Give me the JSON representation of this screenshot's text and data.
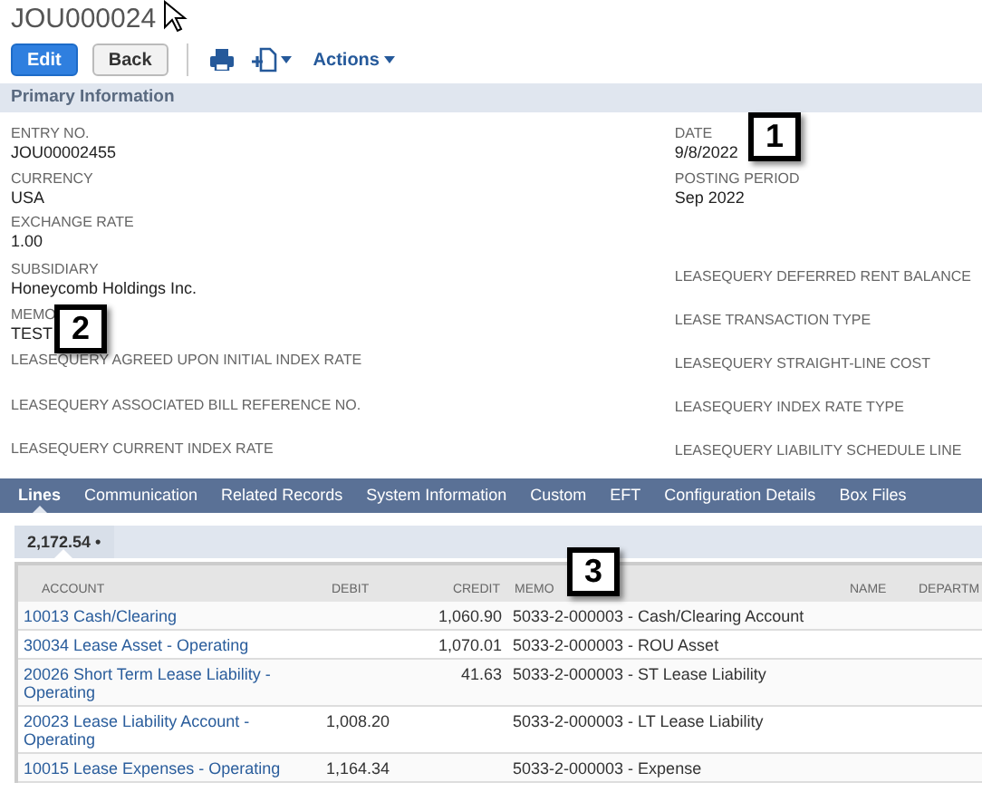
{
  "record": {
    "title": "JOU000024"
  },
  "toolbar": {
    "buttons": [
      {
        "label": "Edit",
        "kind": "primary"
      },
      {
        "label": "Back",
        "kind": "secondary"
      }
    ],
    "actions": {
      "label": "Actions"
    }
  },
  "primary_information": {
    "title": "Primary Information",
    "left_fields": [
      {
        "label": "ENTRY NO.",
        "value": "JOU00002455"
      },
      {
        "label": "CURRENCY",
        "value": "USA"
      },
      {
        "label": "EXCHANGE RATE",
        "value": "1.00"
      },
      {
        "label": "SUBSIDIARY",
        "value": "Honeycomb Holdings Inc."
      },
      {
        "label": "MEMO",
        "value": "TEST"
      },
      {
        "label": "LEASEQUERY AGREED UPON INITIAL INDEX RATE"
      },
      {
        "label": "LEASEQUERY ASSOCIATED BILL REFERENCE NO."
      },
      {
        "label": "LEASEQUERY CURRENT INDEX RATE"
      }
    ],
    "right_fields": [
      {
        "label": "DATE",
        "value": "9/8/2022"
      },
      {
        "label": "POSTING PERIOD",
        "value": "Sep 2022"
      },
      {
        "label": "LEASEQUERY DEFERRED RENT BALANCE"
      },
      {
        "label": "LEASE TRANSACTION TYPE"
      },
      {
        "label": "LEASEQUERY STRAIGHT-LINE COST"
      },
      {
        "label": "LEASEQUERY INDEX RATE TYPE"
      },
      {
        "label": "LEASEQUERY LIABILITY SCHEDULE LINE"
      }
    ]
  },
  "tabs": [
    {
      "label": "Lines",
      "selected": true
    },
    {
      "label": "Communication",
      "selected": false
    },
    {
      "label": "Related Records",
      "selected": false
    },
    {
      "label": "System Information",
      "selected": false
    },
    {
      "label": "Custom",
      "selected": false
    },
    {
      "label": "EFT",
      "selected": false
    },
    {
      "label": "Configuration Details",
      "selected": false
    },
    {
      "label": "Box Files",
      "selected": false
    }
  ],
  "subtabs": [
    {
      "label": "2,172.54 •",
      "selected": true
    }
  ],
  "table": {
    "columns": [
      "ACCOUNT",
      "DEBIT",
      "CREDIT",
      "MEMO",
      "NAME",
      "DEPARTM"
    ],
    "rows": [
      {
        "account": "10013 Cash/Clearing",
        "debit": "",
        "credit": "1,060.90",
        "memo": "5033-2-000003 - Cash/Clearing Account"
      },
      {
        "account": "30034 Lease Asset - Operating",
        "debit": "",
        "credit": "1,070.01",
        "memo": "5033-2-000003 - ROU Asset"
      },
      {
        "account": "20026 Short Term Lease Liability - Operating",
        "debit": "",
        "credit": "41.63",
        "memo": "5033-2-000003 - ST Lease Liability"
      },
      {
        "account": "20023 Lease Liability Account - Operating",
        "debit": "1,008.20",
        "credit": "",
        "memo": "5033-2-000003 - LT Lease Liability"
      },
      {
        "account": "10015 Lease Expenses - Operating",
        "debit": "1,164.34",
        "credit": "",
        "memo": "5033-2-000003 - Expense"
      }
    ]
  },
  "callouts": [
    {
      "label": "1"
    },
    {
      "label": "2"
    },
    {
      "label": "3"
    }
  ]
}
